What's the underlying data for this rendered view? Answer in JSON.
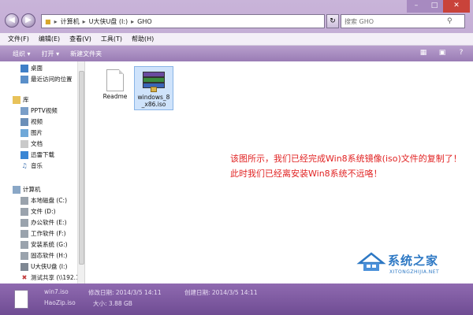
{
  "address": {
    "path": [
      "计算机",
      "U大侠U盘 (I:)",
      "GHO"
    ],
    "search_placeholder": "搜索 GHO"
  },
  "menu": [
    "文件(F)",
    "编辑(E)",
    "查看(V)",
    "工具(T)",
    "帮助(H)"
  ],
  "toolbar": {
    "organize": "组织 ▾",
    "open": "打开 ▾",
    "new_folder": "新建文件夹"
  },
  "sidebar": [
    {
      "label": "桌面",
      "icon": "desktop-icon"
    },
    {
      "label": "最近访问的位置",
      "icon": "recent-icon"
    },
    {
      "label": "库",
      "icon": "library-icon"
    },
    {
      "label": "PPTV视频",
      "icon": "video-library-icon"
    },
    {
      "label": "视频",
      "icon": "video-icon"
    },
    {
      "label": "图片",
      "icon": "pictures-icon"
    },
    {
      "label": "文档",
      "icon": "documents-icon"
    },
    {
      "label": "迅雷下载",
      "icon": "download-icon"
    },
    {
      "label": "音乐",
      "icon": "music-icon"
    },
    {
      "label": "计算机",
      "icon": "computer-icon"
    },
    {
      "label": "本地磁盘 (C:)",
      "icon": "drive-icon"
    },
    {
      "label": "文件 (D:)",
      "icon": "drive-icon"
    },
    {
      "label": "办公软件 (E:)",
      "icon": "drive-icon"
    },
    {
      "label": "工作软件 (F:)",
      "icon": "drive-icon"
    },
    {
      "label": "安装系统 (G:)",
      "icon": "drive-icon"
    },
    {
      "label": "固态软件 (H:)",
      "icon": "drive-icon"
    },
    {
      "label": "U大侠U盘 (I:)",
      "icon": "usb-drive-icon"
    },
    {
      "label": "测试共享 (\\\\192.1",
      "icon": "network-drive-icon"
    }
  ],
  "files": [
    {
      "name": "Readme",
      "icon": "text-file-icon",
      "selected": false
    },
    {
      "name": "windows_8_x86.iso",
      "name_line1": "windows_8",
      "name_line2": "_x86.iso",
      "icon": "winrar-archive-icon",
      "selected": true
    }
  ],
  "note": {
    "line1": "该图所示，我们已经完成Win8系统镜像(iso)文件的复制了！",
    "line2": "此时我们已经离安装Win8系统不远咯！",
    "color": "#e12222"
  },
  "watermark": {
    "text": "系统之家",
    "sub": "XITONGZHIJIA.NET"
  },
  "details": {
    "file_name": "win7.iso",
    "modified_label": "修改日期: 2014/3/5 14:11",
    "created_label": "创建日期: 2014/3/5 14:11",
    "app_name": "HaoZip.iso",
    "size_label": "大小: 3.88 GB"
  }
}
